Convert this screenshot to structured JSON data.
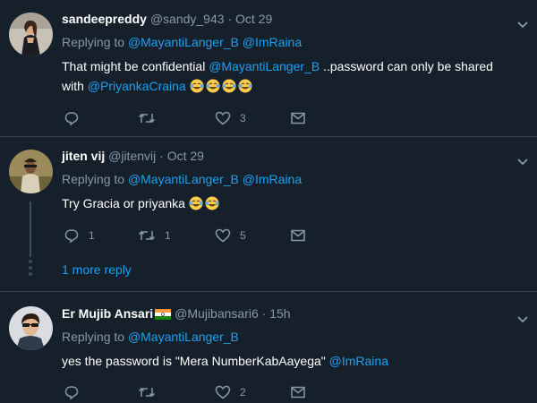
{
  "tweets": [
    {
      "name": "sandeepreddy",
      "handle": "@sandy_943",
      "sep": "·",
      "time": "Oct 29",
      "replying_label": "Replying to",
      "replying_to": [
        "@MayantiLanger_B",
        "@ImRaina"
      ],
      "text_a": "That might be confidential ",
      "text_mention_a": "@MayantiLanger_B",
      "text_b": " ..password can only be shared with ",
      "text_mention_b": "@PriyankaCraina",
      "emoji": "laughing-tears-emoji",
      "counts": {
        "reply": "",
        "retweet": "",
        "like": "3"
      }
    },
    {
      "name": "jiten vij",
      "handle": "@jitenvij",
      "sep": "·",
      "time": "Oct 29",
      "replying_label": "Replying to",
      "replying_to": [
        "@MayantiLanger_B",
        "@ImRaina"
      ],
      "text_a": "Try Gracia or priyanka",
      "counts": {
        "reply": "1",
        "retweet": "1",
        "like": "5"
      },
      "more_replies": "1 more reply"
    },
    {
      "name": "Er Mujib Ansari",
      "flag": "india-flag-icon",
      "handle": "@Mujibansari6",
      "sep": "·",
      "time": "15h",
      "replying_label": "Replying to",
      "replying_to": [
        "@MayantiLanger_B"
      ],
      "text_a": "yes the password is \"Mera NumberKabAayega\" ",
      "text_mention_a": "@ImRaina",
      "counts": {
        "reply": "",
        "retweet": "",
        "like": "2"
      }
    }
  ],
  "colors": {
    "background": "#15202b",
    "divider": "#38444d",
    "accent": "#1da1f2",
    "muted": "#8899a6"
  }
}
